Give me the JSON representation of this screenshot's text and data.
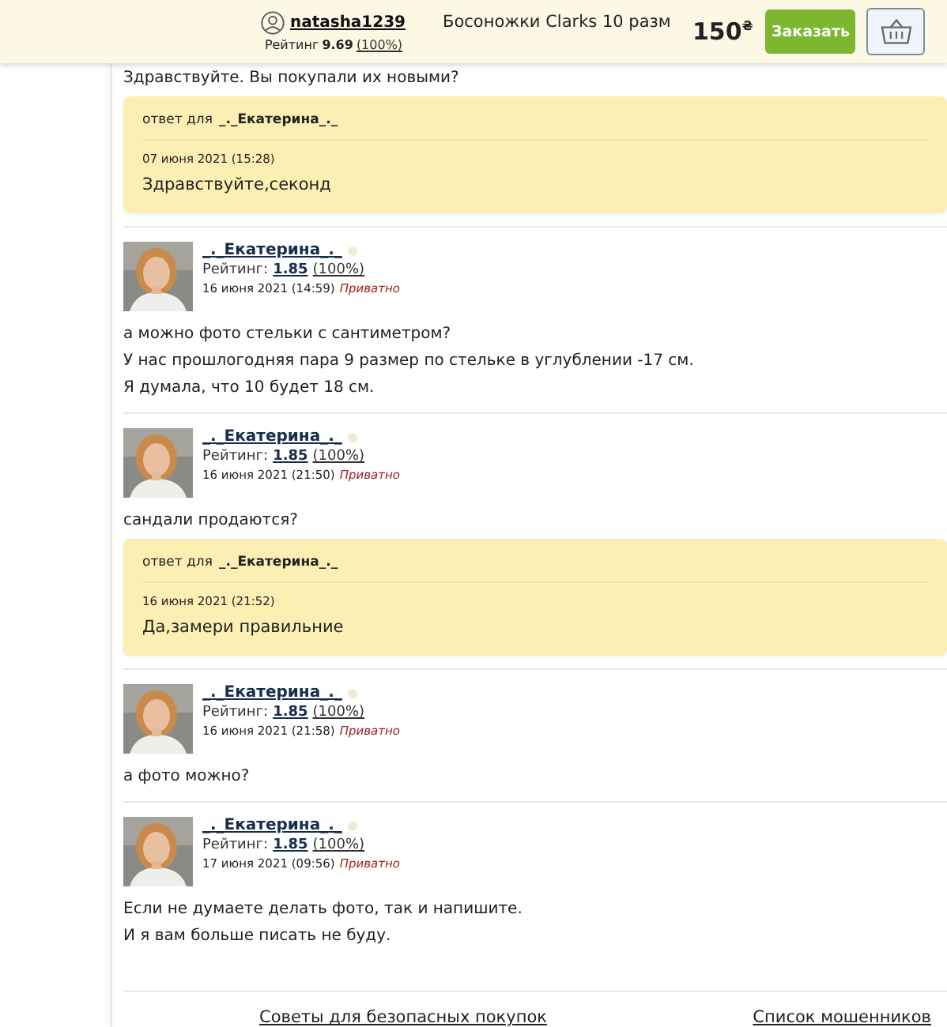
{
  "header": {
    "username": "natasha1239",
    "rating_label": "Рейтинг",
    "rating": "9.69",
    "percent": "(100%)",
    "title": "Босоножки Clarks 10 разм",
    "price": "150",
    "currency": "₴",
    "order_button": "Заказать"
  },
  "feed": [
    {
      "kind": "text",
      "lines": [
        "Здравствуйте. Вы покупали их новыми?"
      ]
    },
    {
      "kind": "reply",
      "reply_label": "ответ для",
      "reply_to": "_._Екатерина_._",
      "date": "07 июня 2021 (15:28)",
      "text": "Здравствуйте,секонд"
    },
    {
      "kind": "message",
      "author": "_._Екатерина_._",
      "rating_label": "Рейтинг:",
      "rating": "1.85",
      "percent": "(100%)",
      "date": "16 июня 2021 (14:59)",
      "privacy": "Приватно",
      "lines": [
        "а можно фото стельки с сантиметром?",
        "У нас прошлогодняя пара 9 размер по стельке в углублении -17 см.",
        "Я думала, что 10 будет 18 см."
      ]
    },
    {
      "kind": "message",
      "author": "_._Екатерина_._",
      "rating_label": "Рейтинг:",
      "rating": "1.85",
      "percent": "(100%)",
      "date": "16 июня 2021 (21:50)",
      "privacy": "Приватно",
      "lines": [
        "сандали продаются?"
      ]
    },
    {
      "kind": "reply",
      "reply_label": "ответ для",
      "reply_to": "_._Екатерина_._",
      "date": "16 июня 2021 (21:52)",
      "text": "Да,замери правильние"
    },
    {
      "kind": "message",
      "author": "_._Екатерина_._",
      "rating_label": "Рейтинг:",
      "rating": "1.85",
      "percent": "(100%)",
      "date": "16 июня 2021 (21:58)",
      "privacy": "Приватно",
      "lines": [
        "а фото можно?"
      ]
    },
    {
      "kind": "message",
      "author": "_._Екатерина_._",
      "rating_label": "Рейтинг:",
      "rating": "1.85",
      "percent": "(100%)",
      "date": "17 июня 2021 (09:56)",
      "privacy": "Приватно",
      "lines": [
        "Если не думаете делать фото, так и напишите.",
        "И я вам больше писать не буду."
      ]
    }
  ],
  "footer_links": [
    "Советы для безопасных покупок",
    "Список мошенников"
  ]
}
